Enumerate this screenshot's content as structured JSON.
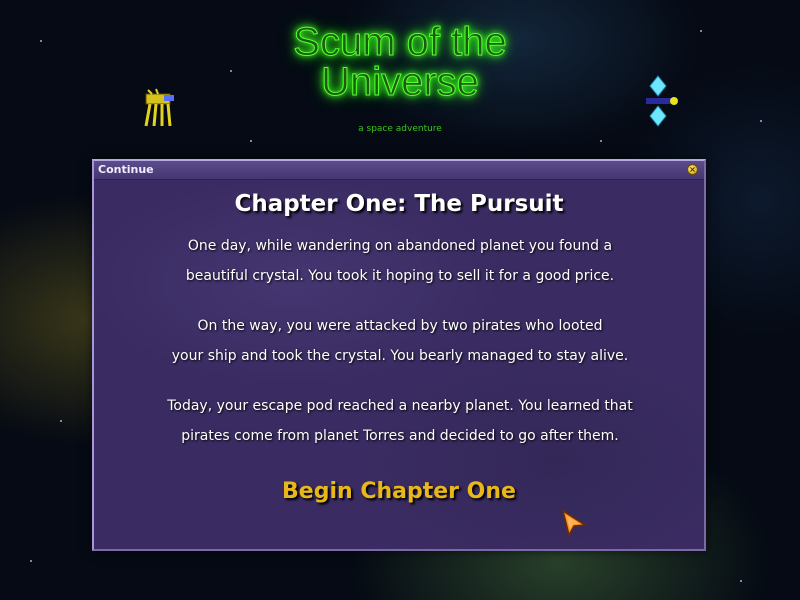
{
  "game": {
    "title_line1": "Scum of the",
    "title_line2": "Universe",
    "subtitle": "a space adventure"
  },
  "dialog": {
    "title": "Continue",
    "close_glyph": "×",
    "chapter_title": "Chapter One: The Pursuit",
    "paragraphs": [
      {
        "line1": "One day, while wandering on abandoned planet you found a",
        "line2": "beautiful crystal. You took it hoping to sell it for a good price."
      },
      {
        "line1": "On the way, you were attacked by two pirates who looted",
        "line2": "your ship and took the crystal. You bearly managed to stay alive."
      },
      {
        "line1": "Today, your escape pod reached a nearby planet. You learned that",
        "line2": "pirates come from planet Torres and decided to go after them."
      }
    ],
    "begin_label": "Begin Chapter One"
  },
  "colors": {
    "title_glow": "#36ff1c",
    "dialog_bg": "#3a2c62",
    "begin_text": "#e8b81a",
    "cursor": "#ff8c1a"
  },
  "icons": {
    "left_ship": "walker-robot-icon",
    "right_ship": "crystal-ship-icon",
    "cursor": "mouse-pointer-icon",
    "close": "close-icon"
  }
}
